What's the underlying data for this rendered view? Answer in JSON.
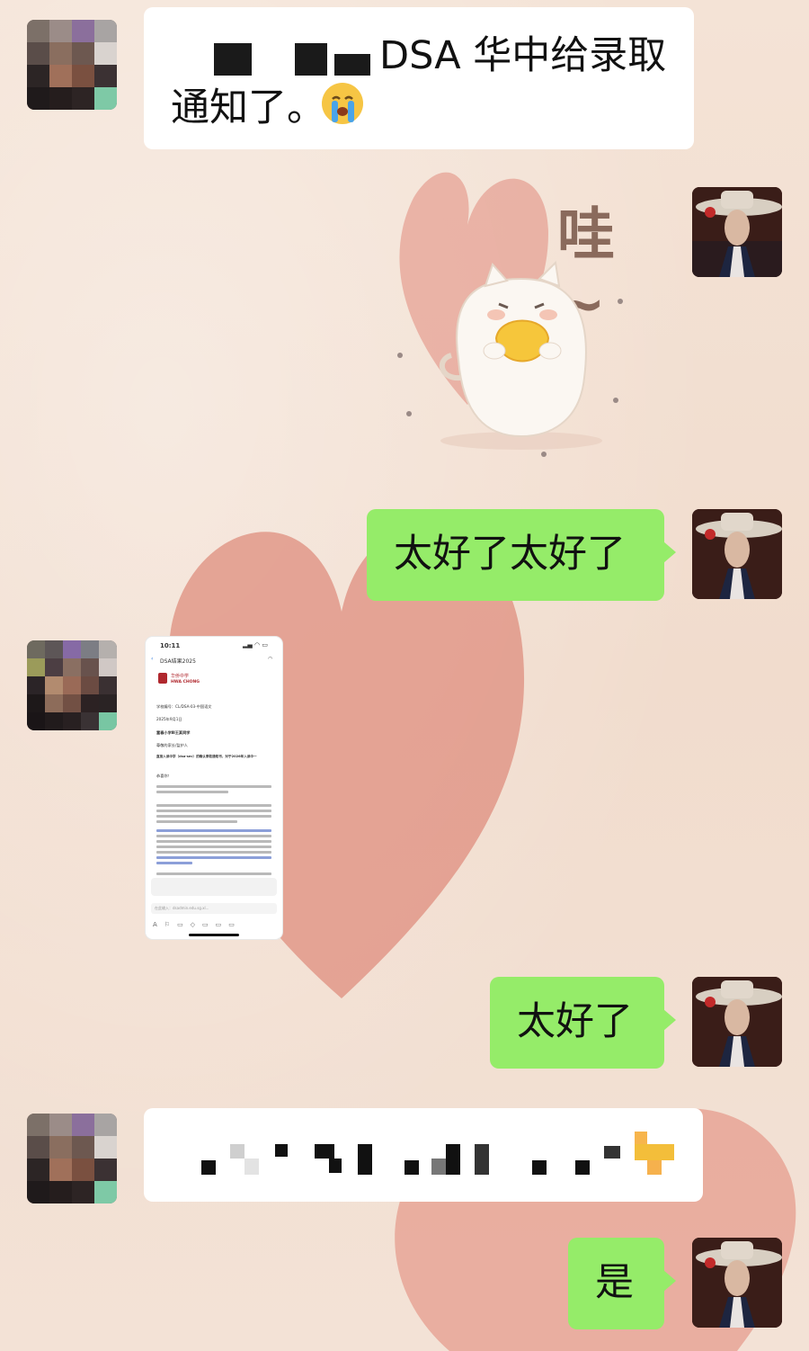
{
  "messages": [
    {
      "side": "left",
      "kind": "text",
      "text": "DSA 华中给录取",
      "line2": "通知了。",
      "emoji_label": "😭"
    },
    {
      "side": "right",
      "kind": "sticker",
      "sticker_text": "哇~"
    },
    {
      "side": "right",
      "kind": "text",
      "text": "太好了太好了"
    },
    {
      "side": "left",
      "kind": "image",
      "image": {
        "status_time": "10:11",
        "header": "DSA结果2025",
        "logo_cn": "华侨中学",
        "logo_en": "HWA CHONG",
        "ref": "学校编号：CL/DSA-03-中国语文",
        "date": "2025年9月1日",
        "recipient": "富春小学Ⅲ王某同学",
        "salutation": "尊敬的家长/监护人",
        "subject": "直接入读中学（dsa-sec）的确认录取通知书，对于2026年入读中一",
        "greeting": "恭喜你！",
        "search_placeholder": "在此输入：dsadmin.edu.sg.xl..."
      }
    },
    {
      "side": "right",
      "kind": "text",
      "text": "太好了"
    },
    {
      "side": "left",
      "kind": "text",
      "text": "",
      "pixelated": true
    },
    {
      "side": "right",
      "kind": "text",
      "text": "是"
    }
  ],
  "colors": {
    "green_bubble": "#95ec69",
    "white_bubble": "#ffffff",
    "background": "#f3e1d3"
  }
}
